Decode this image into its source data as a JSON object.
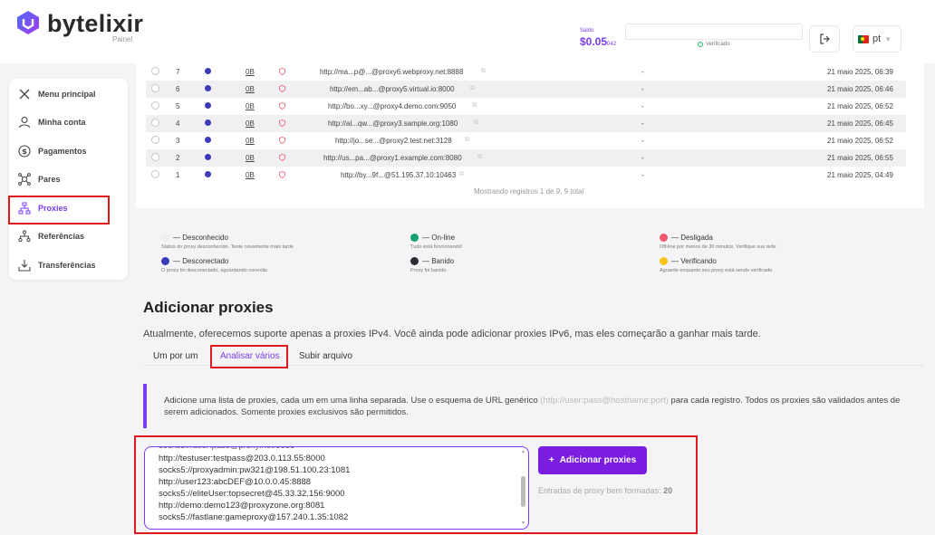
{
  "brand": {
    "name": "bytelixir",
    "subtitle": "Painel"
  },
  "header": {
    "balance_label": "Saldo",
    "balance_value": "$0.05",
    "balance_small": "042",
    "verified_label": "Verificado",
    "language": "pt"
  },
  "sidebar": {
    "items": [
      {
        "label": "Menu principal",
        "icon": "close-icon"
      },
      {
        "label": "Minha conta",
        "icon": "user-icon"
      },
      {
        "label": "Pagamentos",
        "icon": "dollar-icon"
      },
      {
        "label": "Pares",
        "icon": "peers-icon"
      },
      {
        "label": "Proxies",
        "icon": "network-icon",
        "active": true
      },
      {
        "label": "Referências",
        "icon": "referrals-icon"
      },
      {
        "label": "Transferências",
        "icon": "download-icon"
      }
    ]
  },
  "table": {
    "rows": [
      {
        "id": "7",
        "traffic": "0B",
        "url": "http://ma...p@...@proxy6.webproxy.net:8888",
        "info": "-",
        "date": "21 maio 2025, 06:39"
      },
      {
        "id": "6",
        "traffic": "0B",
        "url": "http://em...ab...@proxy5.virtual.io:8000",
        "info": "-",
        "date": "21 maio 2025, 06:46"
      },
      {
        "id": "5",
        "traffic": "0B",
        "url": "http://bo...xy...@proxy4.demo.com:9050",
        "info": "-",
        "date": "21 maio 2025, 06:52"
      },
      {
        "id": "4",
        "traffic": "0B",
        "url": "http://al...qw...@proxy3.sample.org:1080",
        "info": "-",
        "date": "21 maio 2025, 06:45"
      },
      {
        "id": "3",
        "traffic": "0B",
        "url": "http://jo...se...@proxy2.test.net:3128",
        "info": "-",
        "date": "21 maio 2025, 06:52"
      },
      {
        "id": "2",
        "traffic": "0B",
        "url": "http://us...pa...@proxy1.example.com:8080",
        "info": "-",
        "date": "21 maio 2025, 06:55"
      },
      {
        "id": "1",
        "traffic": "0B",
        "url": "http://by...9f...@51.195.37.10:10463",
        "info": "-",
        "date": "21 maio 2025, 04:49"
      }
    ],
    "footer": "Mostrando registros 1 de 9, 9 total",
    "status_color": "#3b3bb8"
  },
  "legend": [
    {
      "label": "— Desconhecido",
      "desc": "Status do proxy desconhecido. Tente novamente mais tarde",
      "color": "#eeeeee"
    },
    {
      "label": "— On-line",
      "desc": "Tudo está funcionando!",
      "color": "#16a06b"
    },
    {
      "label": "— Desligada",
      "desc": "Off-line por menos de 30 minutos. Verifique sua rede",
      "color": "#ef5b6c"
    },
    {
      "label": "— Desconectado",
      "desc": "O proxy foi desconectado, aguardando conexão",
      "color": "#3b3bb8"
    },
    {
      "label": "— Banido",
      "desc": "Proxy foi banido",
      "color": "#2a2d35"
    },
    {
      "label": "— Verificando",
      "desc": "Aguarde enquanto seu proxy está sendo verificado",
      "color": "#f7c31a"
    }
  ],
  "add_section": {
    "title": "Adicionar proxies",
    "description": "Atualmente, oferecemos suporte apenas a proxies IPv4. Você ainda pode adicionar proxies IPv6, mas eles começarão a ganhar mais tarde.",
    "tabs": [
      "Um por um",
      "Analisar vários",
      "Subir arquivo"
    ],
    "info_before": "Adicione uma lista de proxies, cada um em uma linha separada. Use o esquema de URL genérico ",
    "info_url": "(http://user:pass@hostname:port)",
    "info_after": " para cada registro. Todos os proxies são validados antes de serem adicionados. Somente proxies exclusivos são permitidos.",
    "textarea_lines": [
      "http://testuser:testpass@203.0.113.55:8000",
      "socks5://proxyadmin:pw321@198.51.100.23:1081",
      "http://user123:abcDEF@10.0.0.45:8888",
      "socks5://eliteUser:topsecret@45.33.32.156:9000",
      "http://demo:demo123@proxyzone.org:8081",
      "socks5://fastlane:gameproxy@157.240.1.35:1082"
    ],
    "add_button": "Adicionar proxies",
    "valid_label": "Entradas de proxy bem formadas:",
    "valid_count": "20"
  }
}
